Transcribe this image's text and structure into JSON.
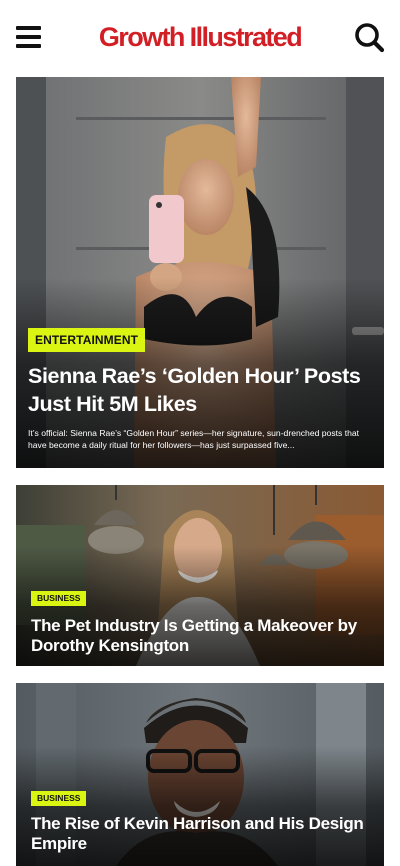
{
  "header": {
    "brand": "Growth Illustrated",
    "menu_icon": "hamburger-menu-icon",
    "search_icon": "search-icon",
    "brand_color": "#d21f26"
  },
  "badge_color": "#d9f511",
  "articles": [
    {
      "category": "ENTERTAINMENT",
      "title": "Sienna Rae’s ‘Golden Hour’ Posts Just Hit 5M Likes",
      "excerpt": "It’s official: Sienna Rae’s “Golden Hour” series—her signature, sun-drenched posts that have become a daily ritual for her followers—has just surpassed five..."
    },
    {
      "category": "BUSINESS",
      "title": "The Pet Industry Is Getting a Makeover by Dorothy Kensington"
    },
    {
      "category": "BUSINESS",
      "title": "The Rise of Kevin Harrison and His Design Empire"
    }
  ]
}
